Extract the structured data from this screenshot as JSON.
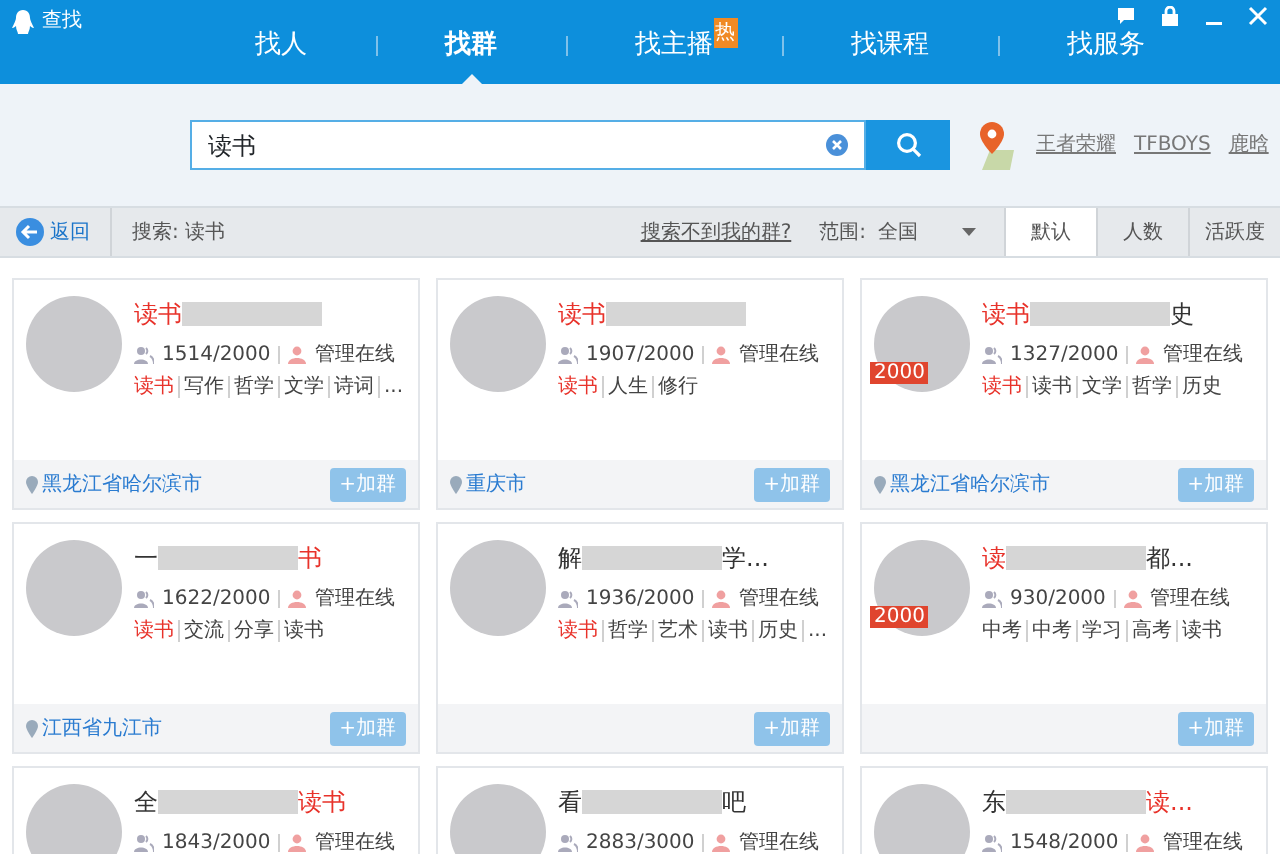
{
  "window": {
    "title": "查找"
  },
  "tabs": [
    {
      "label": "找人",
      "selected": false
    },
    {
      "label": "找群",
      "selected": true
    },
    {
      "label": "找主播",
      "selected": false,
      "badge": "热"
    },
    {
      "label": "找课程",
      "selected": false
    },
    {
      "label": "找服务",
      "selected": false
    }
  ],
  "search": {
    "value": "读书"
  },
  "hot_tags": [
    "王者荣耀",
    "TFBOYS",
    "鹿晗"
  ],
  "filter_bar": {
    "back": "返回",
    "query": "搜索: 读书",
    "help_link": "搜索不到我的群?",
    "range_label": "范围:",
    "range_value": "全国",
    "sort_tabs": [
      {
        "label": "默认",
        "selected": true
      },
      {
        "label": "人数",
        "selected": false
      },
      {
        "label": "活跃度",
        "selected": false
      }
    ]
  },
  "groups": [
    {
      "name": [
        {
          "kind": "text",
          "text": "读书",
          "highlight": true
        },
        {
          "kind": "blur"
        }
      ],
      "members": "1514/2000",
      "admin": "管理在线",
      "tags": [
        {
          "text": "读书",
          "highlight": true
        },
        {
          "text": "写作",
          "highlight": false
        },
        {
          "text": "哲学",
          "highlight": false
        },
        {
          "text": "文学",
          "highlight": false
        },
        {
          "text": "诗词",
          "highlight": false
        },
        {
          "text": "...",
          "highlight": false
        }
      ],
      "location": "黑龙江省哈尔滨市",
      "join": "+加群"
    },
    {
      "name": [
        {
          "kind": "text",
          "text": "读书",
          "highlight": true
        },
        {
          "kind": "blur"
        }
      ],
      "members": "1907/2000",
      "admin": "管理在线",
      "tags": [
        {
          "text": "读书",
          "highlight": true
        },
        {
          "text": "人生",
          "highlight": false
        },
        {
          "text": "修行",
          "highlight": false
        }
      ],
      "location": "重庆市",
      "join": "+加群"
    },
    {
      "name": [
        {
          "kind": "text",
          "text": "读书",
          "highlight": true
        },
        {
          "kind": "blur"
        },
        {
          "kind": "text",
          "text": "史",
          "highlight": false
        }
      ],
      "badge": "2000",
      "members": "1327/2000",
      "admin": "管理在线",
      "tags": [
        {
          "text": "读书",
          "highlight": true
        },
        {
          "text": "读书",
          "highlight": false
        },
        {
          "text": "文学",
          "highlight": false
        },
        {
          "text": "哲学",
          "highlight": false
        },
        {
          "text": "历史",
          "highlight": false
        }
      ],
      "location": "黑龙江省哈尔滨市",
      "join": "+加群"
    },
    {
      "name": [
        {
          "kind": "text",
          "text": "一",
          "highlight": false
        },
        {
          "kind": "blur"
        },
        {
          "kind": "text",
          "text": "书",
          "highlight": true
        }
      ],
      "members": "1622/2000",
      "admin": "管理在线",
      "tags": [
        {
          "text": "读书",
          "highlight": true
        },
        {
          "text": "交流",
          "highlight": false
        },
        {
          "text": "分享",
          "highlight": false
        },
        {
          "text": "读书",
          "highlight": false
        }
      ],
      "location": "江西省九江市",
      "join": "+加群"
    },
    {
      "name": [
        {
          "kind": "text",
          "text": "解",
          "highlight": false
        },
        {
          "kind": "blur"
        },
        {
          "kind": "text",
          "text": "学...",
          "highlight": false
        }
      ],
      "members": "1936/2000",
      "admin": "管理在线",
      "tags": [
        {
          "text": "读书",
          "highlight": true
        },
        {
          "text": "哲学",
          "highlight": false
        },
        {
          "text": "艺术",
          "highlight": false
        },
        {
          "text": "读书",
          "highlight": false
        },
        {
          "text": "历史",
          "highlight": false
        },
        {
          "text": "...",
          "highlight": false
        }
      ],
      "join": "+加群"
    },
    {
      "name": [
        {
          "kind": "text",
          "text": "读",
          "highlight": true
        },
        {
          "kind": "blur"
        },
        {
          "kind": "text",
          "text": "都...",
          "highlight": false
        }
      ],
      "badge": "2000",
      "members": "930/2000",
      "admin": "管理在线",
      "tags": [
        {
          "text": "中考",
          "highlight": false
        },
        {
          "text": "中考",
          "highlight": false
        },
        {
          "text": "学习",
          "highlight": false
        },
        {
          "text": "高考",
          "highlight": false
        },
        {
          "text": "读书",
          "highlight": false
        }
      ],
      "join": "+加群"
    },
    {
      "name": [
        {
          "kind": "text",
          "text": "全",
          "highlight": false
        },
        {
          "kind": "blur"
        },
        {
          "kind": "text",
          "text": "读书",
          "highlight": true
        }
      ],
      "members": "1843/2000",
      "admin": "管理在线"
    },
    {
      "name": [
        {
          "kind": "text",
          "text": "看",
          "highlight": false
        },
        {
          "kind": "blur"
        },
        {
          "kind": "text",
          "text": "吧",
          "highlight": false
        }
      ],
      "members": "2883/3000",
      "admin": "管理在线"
    },
    {
      "name": [
        {
          "kind": "text",
          "text": "东",
          "highlight": false
        },
        {
          "kind": "blur"
        },
        {
          "kind": "text",
          "text": "读...",
          "highlight": true
        }
      ],
      "members": "1548/2000",
      "admin": "管理在线"
    }
  ]
}
